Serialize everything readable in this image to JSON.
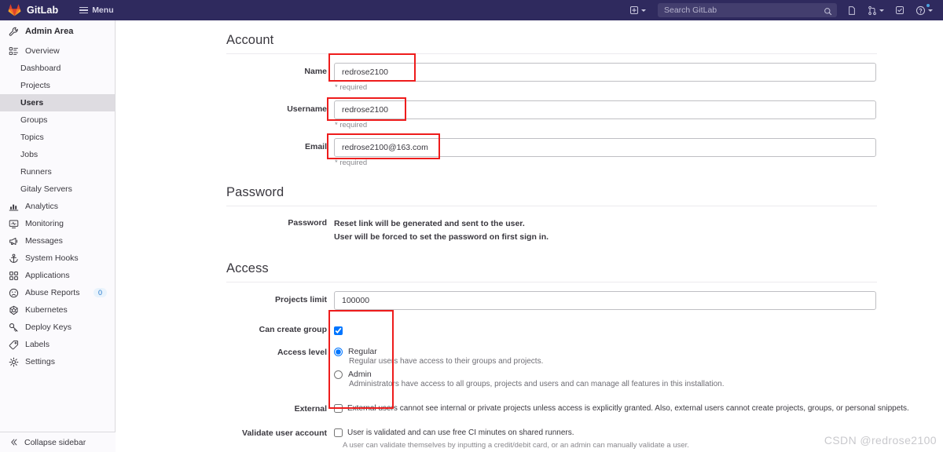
{
  "navbar": {
    "brand": "GitLab",
    "menu_label": "Menu",
    "create_new_label": "+",
    "search": {
      "placeholder": "Search GitLab",
      "value": ""
    },
    "icons": [
      "plus-square-icon",
      "chevron-down-icon",
      "search-icon",
      "issues-icon",
      "merge-request-icon",
      "todos-icon",
      "help-icon"
    ]
  },
  "sidebar": {
    "header": {
      "label": "Admin Area",
      "icon": "wrench-icon"
    },
    "items": [
      {
        "label": "Overview",
        "icon": "overview-icon",
        "level": "top",
        "active": false
      },
      {
        "label": "Dashboard",
        "icon": "",
        "level": "sub",
        "active": false
      },
      {
        "label": "Projects",
        "icon": "",
        "level": "sub",
        "active": false
      },
      {
        "label": "Users",
        "icon": "",
        "level": "sub",
        "active": true
      },
      {
        "label": "Groups",
        "icon": "",
        "level": "sub",
        "active": false
      },
      {
        "label": "Topics",
        "icon": "",
        "level": "sub",
        "active": false
      },
      {
        "label": "Jobs",
        "icon": "",
        "level": "sub",
        "active": false
      },
      {
        "label": "Runners",
        "icon": "",
        "level": "sub",
        "active": false
      },
      {
        "label": "Gitaly Servers",
        "icon": "",
        "level": "sub",
        "active": false
      },
      {
        "label": "Analytics",
        "icon": "chart-icon",
        "level": "top",
        "active": false
      },
      {
        "label": "Monitoring",
        "icon": "monitor-icon",
        "level": "top",
        "active": false
      },
      {
        "label": "Messages",
        "icon": "megaphone-icon",
        "level": "top",
        "active": false
      },
      {
        "label": "System Hooks",
        "icon": "anchor-icon",
        "level": "top",
        "active": false
      },
      {
        "label": "Applications",
        "icon": "applications-icon",
        "level": "top",
        "active": false
      },
      {
        "label": "Abuse Reports",
        "icon": "abuse-icon",
        "level": "top",
        "active": false,
        "badge": "0"
      },
      {
        "label": "Kubernetes",
        "icon": "kubernetes-icon",
        "level": "top",
        "active": false
      },
      {
        "label": "Deploy Keys",
        "icon": "key-icon",
        "level": "top",
        "active": false
      },
      {
        "label": "Labels",
        "icon": "label-icon",
        "level": "top",
        "active": false
      },
      {
        "label": "Settings",
        "icon": "gear-icon",
        "level": "top",
        "active": false
      }
    ],
    "footer": {
      "label": "Collapse sidebar",
      "icon": "double-chevron-left-icon"
    }
  },
  "main": {
    "sections": {
      "account": {
        "heading": "Account",
        "name": {
          "label": "Name",
          "value": "redrose2100",
          "hint": "* required"
        },
        "username": {
          "label": "Username",
          "value": "redrose2100",
          "hint": "* required"
        },
        "email": {
          "label": "Email",
          "value": "redrose2100@163.com",
          "hint": "* required"
        }
      },
      "password": {
        "heading": "Password",
        "label": "Password",
        "line1": "Reset link will be generated and sent to the user.",
        "line2": "User will be forced to set the password on first sign in."
      },
      "access": {
        "heading": "Access",
        "projects_limit": {
          "label": "Projects limit",
          "value": "100000"
        },
        "can_create_group": {
          "label": "Can create group",
          "checked": true
        },
        "access_level": {
          "label": "Access level",
          "selected": "Regular",
          "options": [
            {
              "value": "Regular",
              "description": "Regular users have access to their groups and projects."
            },
            {
              "value": "Admin",
              "description": "Administrators have access to all groups, projects and users and can manage all features in this installation."
            }
          ]
        },
        "external": {
          "label": "External",
          "checked": false,
          "text": "External users cannot see internal or private projects unless access is explicitly granted. Also, external users cannot create projects, groups, or personal snippets."
        },
        "validate_user_account": {
          "label": "Validate user account",
          "checked": false,
          "text": "User is validated and can use free CI minutes on shared runners.",
          "subtext": "A user can validate themselves by inputting a credit/debit card, or an admin can manually validate a user."
        }
      }
    }
  },
  "watermark": {
    "text": "CSDN @redrose2100"
  },
  "colors": {
    "navbar": "#2f2a5e",
    "accent": "#1f75cb",
    "annotation": "#ee1c1c",
    "sidebar_bg": "#fbfafd",
    "active_item": "#dedce1"
  }
}
